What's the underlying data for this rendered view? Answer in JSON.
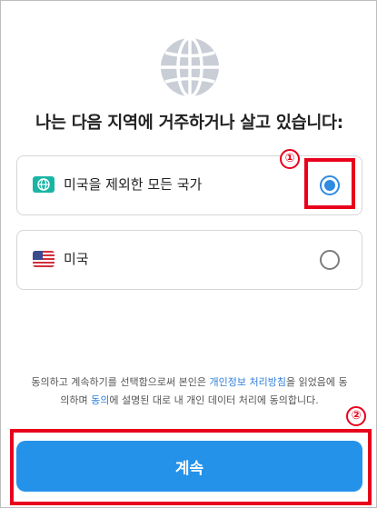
{
  "heading": "나는 다음 지역에 거주하거나 살고 있습니다:",
  "options": [
    {
      "label": "미국을 제외한 모든 국가",
      "icon": "world-icon",
      "selected": true
    },
    {
      "label": "미국",
      "icon": "us-flag-icon",
      "selected": false
    }
  ],
  "annotations": {
    "marker1": "①",
    "marker2": "②"
  },
  "consent": {
    "part1": "동의하고 계속하기를 선택함으로써 본인은 ",
    "link1": "개인정보 처리방침",
    "part2": "을 읽었음에 동의하며 ",
    "link2": "동의",
    "part3": "에 설명된 대로 내 개인 데이터 처리에 동의합니다."
  },
  "continue_label": "계속",
  "colors": {
    "accent": "#2592ea",
    "highlight": "#e8001c",
    "link": "#2f7fd9"
  }
}
